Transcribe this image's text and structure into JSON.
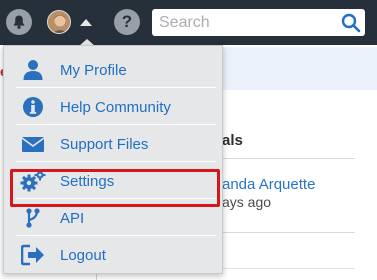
{
  "topbar": {
    "search_placeholder": "Search"
  },
  "background_page": {
    "red_fragment": "e",
    "heading_fragment": "als",
    "name_fragment": "anda Arquette",
    "time_fragment": "ays ago"
  },
  "menu": {
    "items": [
      {
        "label": "My Profile",
        "icon": "person-icon"
      },
      {
        "label": "Help Community",
        "icon": "info-icon"
      },
      {
        "label": "Support Files",
        "icon": "envelope-icon"
      },
      {
        "label": "Settings",
        "icon": "gears-icon"
      },
      {
        "label": "API",
        "icon": "branch-icon"
      },
      {
        "label": "Logout",
        "icon": "sign-out-icon"
      }
    ],
    "highlighted_item": "Support Files"
  },
  "colors": {
    "topbar": "#26303a",
    "menu_text": "#1f6fc5",
    "menu_icon": "#2b6fbf",
    "highlight_border": "#d4161d"
  }
}
